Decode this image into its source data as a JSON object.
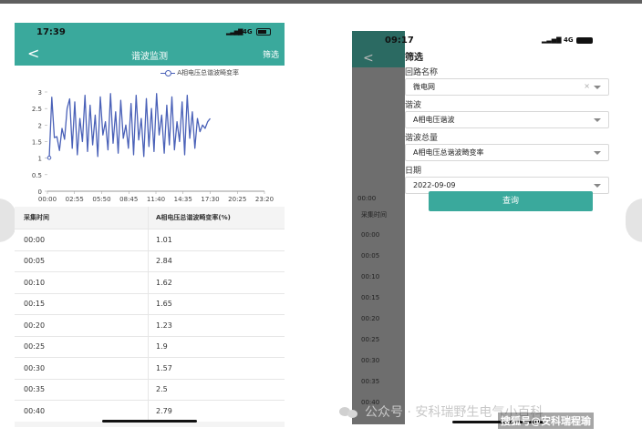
{
  "left_phone": {
    "status": {
      "time": "17:39",
      "network": "4G"
    },
    "nav": {
      "back": "<",
      "title": "谐波监测",
      "filter": "筛选"
    },
    "legend": "A相电压总谐波畸变率",
    "table": {
      "headers": [
        "采集时间",
        "A相电压总谐波畸变率(%)"
      ],
      "rows": [
        [
          "00:00",
          "1.01"
        ],
        [
          "00:05",
          "2.84"
        ],
        [
          "00:10",
          "1.62"
        ],
        [
          "00:15",
          "1.65"
        ],
        [
          "00:20",
          "1.23"
        ],
        [
          "00:25",
          "1.9"
        ],
        [
          "00:30",
          "1.57"
        ],
        [
          "00:35",
          "2.5"
        ],
        [
          "00:40",
          "2.79"
        ]
      ]
    }
  },
  "chart_data": {
    "type": "line",
    "title": "",
    "xlabel": "",
    "ylabel": "",
    "x_ticks": [
      "00:00",
      "02:55",
      "05:50",
      "08:45",
      "11:40",
      "14:35",
      "17:30",
      "20:25",
      "23:20"
    ],
    "y_ticks": [
      "0",
      "0.5",
      "1",
      "1.5",
      "2",
      "2.5",
      "3"
    ],
    "ylim": [
      0,
      3
    ],
    "series": [
      {
        "name": "A相电压总谐波畸变率",
        "color": "#4a61b8",
        "x_minutes": [
          0,
          5,
          10,
          15,
          20,
          25,
          30,
          35,
          40
        ],
        "values": [
          1.01,
          2.84,
          1.62,
          1.65,
          1.23,
          1.9,
          1.57,
          2.5,
          2.79,
          1.3,
          2.7,
          1.1,
          2.2,
          1.5,
          2.9,
          1.2,
          2.6,
          1.4,
          2.3,
          1.05,
          2.85,
          1.7,
          2.1,
          1.25,
          2.95,
          1.45,
          2.4,
          1.15,
          2.75,
          1.6,
          2.0,
          1.3,
          2.65,
          1.1,
          2.9,
          1.55,
          2.2,
          1.05,
          2.8,
          1.35,
          2.5,
          1.2,
          2.95,
          1.7,
          2.3,
          1.15,
          2.6,
          1.4,
          2.85,
          1.25,
          2.1,
          1.5,
          2.7,
          1.1,
          2.9,
          1.6,
          2.4,
          1.3,
          2.2,
          1.8,
          2.0,
          1.9,
          2.1,
          2.2
        ],
        "x_end": "17:30"
      }
    ],
    "grid": false
  },
  "right_phone": {
    "status": {
      "time": "09:17",
      "network": "4G"
    },
    "background": {
      "axis_label": "00:00",
      "header": "采集时间",
      "rows": [
        "00:00",
        "00:05",
        "00:10",
        "00:15",
        "00:20",
        "00:25",
        "00:30",
        "00:35",
        "00:40"
      ]
    },
    "filter_panel": {
      "title": "筛选",
      "fields": [
        {
          "label": "回路名称",
          "value": "微电网",
          "clear": "×"
        },
        {
          "label": "谐波",
          "value": "A相电压谐波"
        },
        {
          "label": "谐波总量",
          "value": "A相电压总谐波畸变率"
        },
        {
          "label": "日期",
          "value": "2022-09-09"
        }
      ],
      "query_button": "查询"
    }
  },
  "watermark": {
    "text": "公众号 · 安科瑞野生电气小百科",
    "badge": "搜狐号@安科瑞程瑜"
  }
}
